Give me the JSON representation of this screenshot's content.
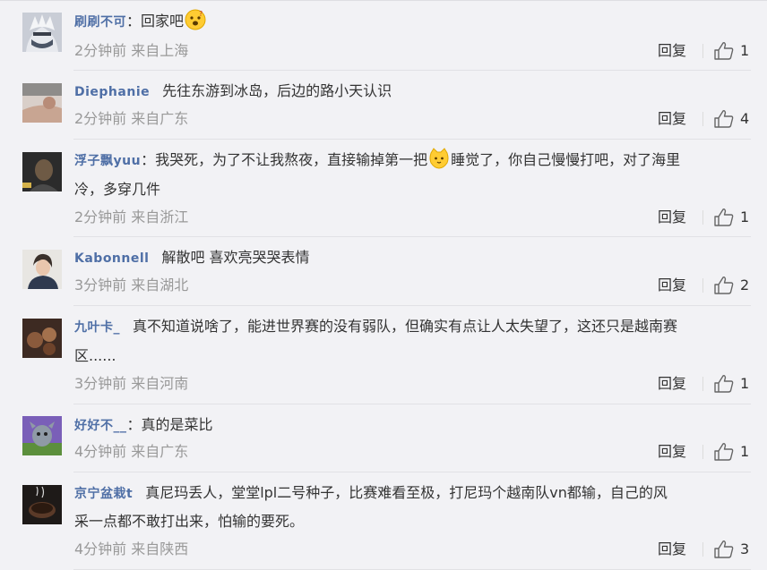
{
  "comments": [
    {
      "username": "刷刷不可",
      "text_before": "回家吧",
      "text_after": "",
      "time": "2分钟前 来自上海",
      "reply_label": "回复",
      "like_count": "1",
      "emoji": "thinking-face-emoji"
    },
    {
      "username": "Diephanie",
      "text_before": "先往东游到冰岛，后边的路小天认识",
      "time": "2分钟前 来自广东",
      "reply_label": "回复",
      "like_count": "4"
    },
    {
      "username": "浮子飘yuu",
      "text_before": "我哭死，为了不让我熬夜，直接输掉第一把",
      "text_after": "睡觉了，你自己慢慢打吧，对了海里",
      "text_line2": "冷，多穿几件",
      "time": "2分钟前 来自浙江",
      "reply_label": "回复",
      "like_count": "1",
      "emoji": "cat-face-emoji"
    },
    {
      "username": "Kabonnell",
      "text_before": "解散吧 喜欢亮哭哭表情",
      "time": "3分钟前 来自湖北",
      "reply_label": "回复",
      "like_count": "2"
    },
    {
      "username": "九叶卡_",
      "text_before": "真不知道说啥了，能进世界赛的没有弱队，但确实有点让人太失望了，这还只是越南赛",
      "text_line2": "区......",
      "time": "3分钟前 来自河南",
      "reply_label": "回复",
      "like_count": "1"
    },
    {
      "username": "好好不__",
      "text_before": "真的是菜比",
      "time": "4分钟前 来自广东",
      "reply_label": "回复",
      "like_count": "1"
    },
    {
      "username": "京宁盆栽t",
      "text_before": "真尼玛丢人，堂堂lpl二号种子，比赛难看至极，打尼玛个越南队vn都输，自己的风",
      "text_line2": "采一点都不敢打出来，怕输的要死。",
      "time": "4分钟前 来自陕西",
      "reply_label": "回复",
      "like_count": "3"
    }
  ],
  "colors": {
    "background": "#f2f2f5",
    "username": "#4f6fa6",
    "meta": "#999999",
    "text": "#333333"
  }
}
